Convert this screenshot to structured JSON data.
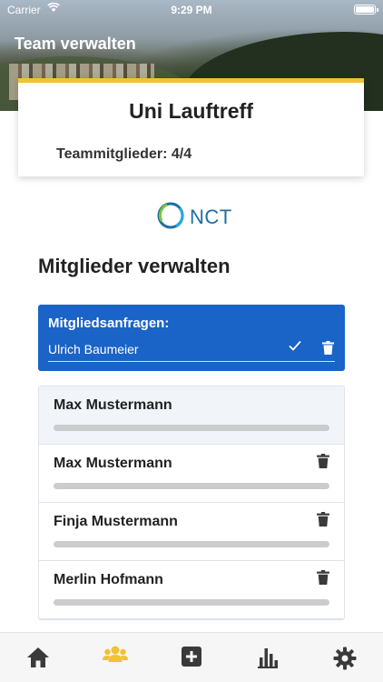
{
  "status_bar": {
    "carrier": "Carrier",
    "time": "9:29 PM"
  },
  "nav": {
    "title": "Team verwalten"
  },
  "team": {
    "name": "Uni Lauftreff",
    "members_label": "Teammitglieder: 4/4"
  },
  "logo": {
    "text": "NCT"
  },
  "section": {
    "heading": "Mitglieder verwalten"
  },
  "requests": {
    "title": "Mitgliedsanfragen:",
    "items": [
      {
        "name": "Ulrich Baumeier"
      }
    ]
  },
  "members": [
    {
      "name": "Max Mustermann",
      "deletable": false
    },
    {
      "name": "Max Mustermann",
      "deletable": true
    },
    {
      "name": "Finja Mustermann",
      "deletable": true
    },
    {
      "name": "Merlin Hofmann",
      "deletable": true
    }
  ],
  "tabbar": {
    "tabs": [
      {
        "icon": "home-icon"
      },
      {
        "icon": "team-icon",
        "active": true
      },
      {
        "icon": "add-icon"
      },
      {
        "icon": "stats-icon"
      },
      {
        "icon": "settings-icon"
      }
    ],
    "active_color": "#f2c232",
    "inactive_color": "#3a3a3a"
  },
  "colors": {
    "accent": "#f2c232",
    "primary": "#1a63c7"
  }
}
